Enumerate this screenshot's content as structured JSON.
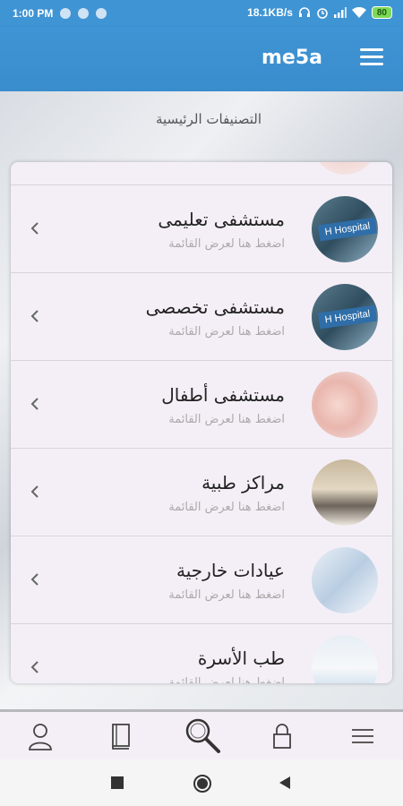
{
  "status": {
    "time": "1:00 PM",
    "net_speed": "18.1KB/s",
    "battery": "80"
  },
  "app": {
    "title": "me5a",
    "section_title": "التصنيفات الرئيسية"
  },
  "categories": [
    {
      "name": "مستشفى تعليمى",
      "hint": "اضغط هنا لعرض القائمة",
      "thumb_label": "H Hospital",
      "thumb": "hospital-building-icon"
    },
    {
      "name": "مستشفى تخصصى",
      "hint": "اضغط هنا لعرض القائمة",
      "thumb_label": "H Hospital",
      "thumb": "hospital-building-icon"
    },
    {
      "name": "مستشفى أطفال",
      "hint": "اضغط هنا لعرض القائمة",
      "thumb": "baby-photo"
    },
    {
      "name": "مراكز طبية",
      "hint": "اضغط هنا لعرض القائمة",
      "thumb": "medical-room-photo"
    },
    {
      "name": "عيادات خارجية",
      "hint": "اضغط هنا لعرض القائمة",
      "thumb": "clinic-photo"
    },
    {
      "name": "طب الأسرة",
      "hint": "اضغط هنا لعرض القائمة",
      "thumb": "doctor-photo"
    }
  ],
  "tabs": [
    "profile-icon",
    "book-icon",
    "search-icon",
    "lock-icon",
    "menu-icon"
  ],
  "colors": {
    "primary": "#3f94d4",
    "card_bg": "#f4eff7"
  }
}
